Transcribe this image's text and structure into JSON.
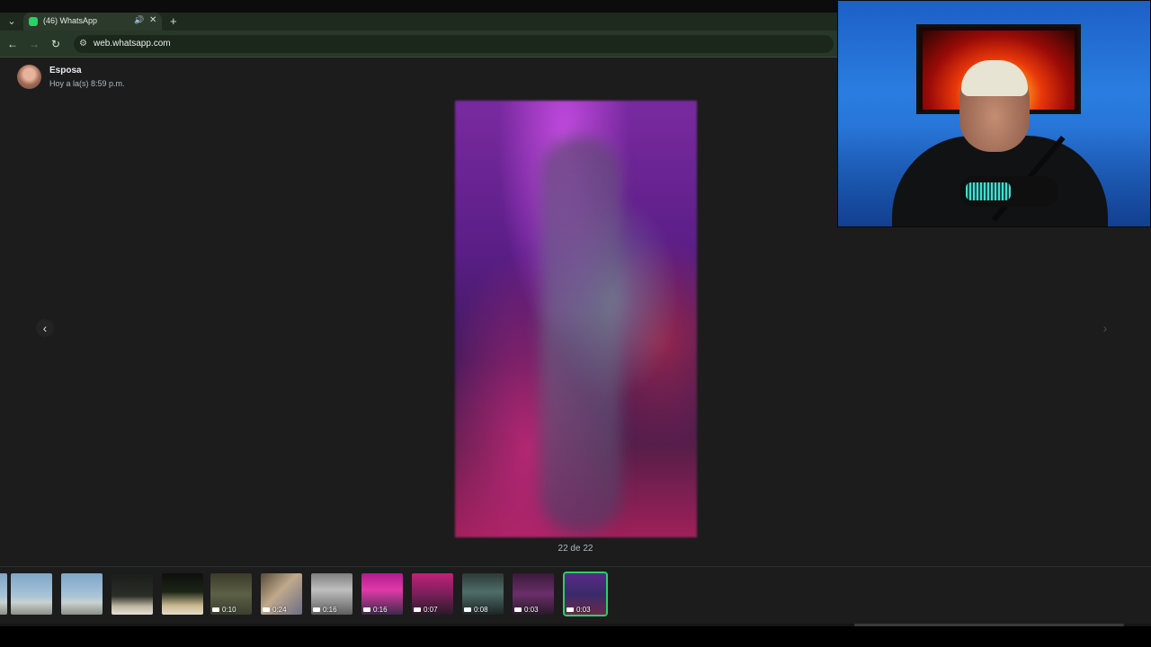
{
  "browser": {
    "tab": {
      "title": "(46) WhatsApp",
      "audio_icon": "speaker-icon",
      "close_glyph": "✕"
    },
    "new_tab_glyph": "+",
    "tab_menu_glyph": "⌄",
    "nav": {
      "back_glyph": "←",
      "forward_glyph": "→",
      "reload_glyph": "↻"
    },
    "site_info_glyph": "⚙",
    "url": "web.whatsapp.com"
  },
  "viewer": {
    "sender_name": "Esposa",
    "sent_time": "Hoy a la(s) 8:59 p.m.",
    "counter": "22 de 22",
    "prev_glyph": "‹",
    "next_glyph": "›",
    "accent_color": "#25d366",
    "thumbnails": [
      {
        "kind": "image",
        "duration": ""
      },
      {
        "kind": "image",
        "duration": ""
      },
      {
        "kind": "image",
        "duration": ""
      },
      {
        "kind": "image",
        "duration": ""
      },
      {
        "kind": "image",
        "duration": ""
      },
      {
        "kind": "video",
        "duration": "0:10"
      },
      {
        "kind": "video",
        "duration": "0:24"
      },
      {
        "kind": "video",
        "duration": "0:16"
      },
      {
        "kind": "video",
        "duration": "0:16"
      },
      {
        "kind": "video",
        "duration": "0:07"
      },
      {
        "kind": "video",
        "duration": "0:08"
      },
      {
        "kind": "video",
        "duration": "0:03"
      },
      {
        "kind": "video",
        "duration": "0:03",
        "selected": true
      }
    ]
  }
}
